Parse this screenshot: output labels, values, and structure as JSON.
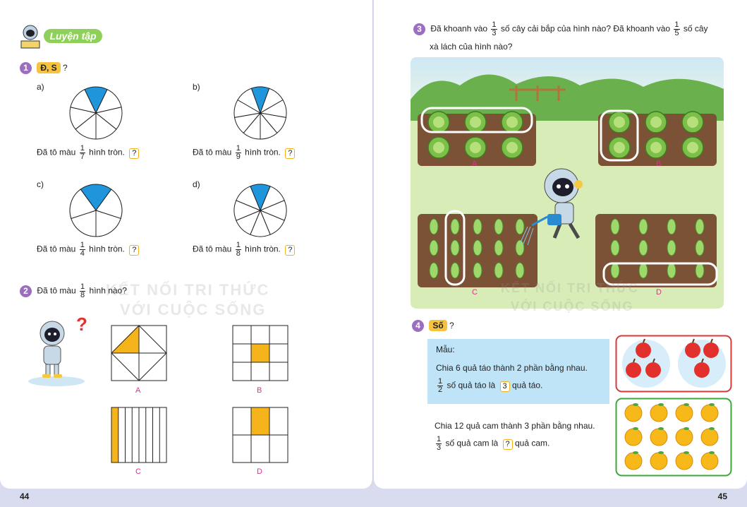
{
  "left_page": {
    "section_title": "Luyện tập",
    "page_number": "44",
    "q1": {
      "number": "1",
      "badge": "Đ, S",
      "suffix": "?",
      "items": [
        {
          "letter": "a)",
          "text_before": "Đã tô màu",
          "num": "1",
          "den": "7",
          "text_after": "hình tròn.",
          "answer": "?"
        },
        {
          "letter": "b)",
          "text_before": "Đã tô màu",
          "num": "1",
          "den": "9",
          "text_after": "hình tròn.",
          "answer": "?"
        },
        {
          "letter": "c)",
          "text_before": "Đã tô màu",
          "num": "1",
          "den": "4",
          "text_after": "hình tròn.",
          "answer": "?"
        },
        {
          "letter": "d)",
          "text_before": "Đã tô màu",
          "num": "1",
          "den": "8",
          "text_after": "hình tròn.",
          "answer": "?"
        }
      ]
    },
    "q2": {
      "number": "2",
      "text_before": "Đã tô màu",
      "num": "1",
      "den": "8",
      "text_after": "hình nào?",
      "labels": [
        "A",
        "B",
        "C",
        "D"
      ]
    },
    "watermark": [
      "KẾT NỐI TRI THỨC",
      "VỚI CUỘC SỐNG"
    ]
  },
  "right_page": {
    "page_number": "45",
    "q3": {
      "number": "3",
      "line1_a": "Đã khoanh vào",
      "num1": "1",
      "den1": "3",
      "line1_b": "số cây cải bắp của hình nào? Đã khoanh vào",
      "num2": "1",
      "den2": "5",
      "line1_c": "số cây",
      "line2": "xà lách của hình nào?",
      "labels": [
        "A",
        "B",
        "C",
        "D"
      ]
    },
    "q4": {
      "number": "4",
      "badge": "Số",
      "suffix": "?",
      "example_title": "Mẫu:",
      "example_line1": "Chia 6 quả táo thành 2 phần bằng nhau.",
      "example_num": "1",
      "example_den": "2",
      "example_line2_a": "số quả táo là",
      "example_answer": "3",
      "example_line2_b": "quả táo.",
      "task_line1": "Chia 12 quả cam thành 3 phần bằng nhau.",
      "task_num": "1",
      "task_den": "3",
      "task_line2_a": "số quả cam là",
      "task_answer": "?",
      "task_line2_b": "quả cam."
    },
    "watermark": [
      "KẾT NỐI TRI THỨC",
      "VỚI CUỘC SỐNG"
    ]
  },
  "colors": {
    "shade_blue": "#1f96dc",
    "shade_orange": "#f5b41c",
    "apple_red": "#e2312c",
    "orange_fruit": "#f7b81a",
    "purple": "#9b6ec0"
  }
}
